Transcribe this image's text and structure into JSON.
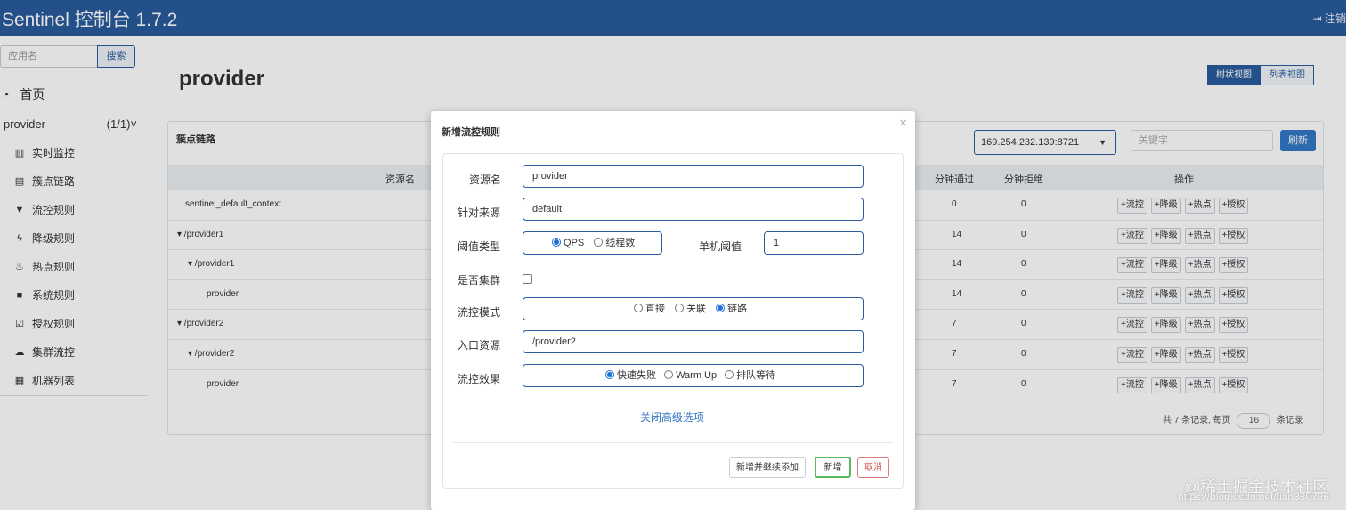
{
  "header": {
    "brand": "Sentinel 控制台 1.7.2",
    "logout": "注销"
  },
  "sidebar": {
    "search_placeholder": "应用名",
    "search_button": "搜索",
    "home": "首页",
    "app_name": "provider",
    "app_count": "(1/1)",
    "items": [
      {
        "icon": "bar-chart-icon",
        "label": "实时监控"
      },
      {
        "icon": "list-icon",
        "label": "簇点链路"
      },
      {
        "icon": "filter-icon",
        "label": "流控规则"
      },
      {
        "icon": "bolt-icon",
        "label": "降级规则"
      },
      {
        "icon": "fire-icon",
        "label": "热点规则"
      },
      {
        "icon": "lock-icon",
        "label": "系统规则"
      },
      {
        "icon": "check-square-icon",
        "label": "授权规则"
      },
      {
        "icon": "cloud-icon",
        "label": "集群流控"
      },
      {
        "icon": "th-list-icon",
        "label": "机器列表"
      }
    ]
  },
  "main": {
    "title": "provider",
    "view_tree": "树状视图",
    "view_list": "列表视图",
    "panel_title": "簇点链路",
    "machine": "169.254.232.139:8721",
    "keyword_placeholder": "关键字",
    "refresh": "刷新",
    "columns": {
      "resource": "资源名",
      "pass": "分钟通过",
      "block": "分钟拒绝",
      "ops": "操作"
    },
    "op_labels": [
      "+流控",
      "+降级",
      "+热点",
      "+授权"
    ],
    "rows": [
      {
        "name": "sentinel_default_context",
        "pass": "0",
        "block": "0"
      },
      {
        "name": "▾ /provider1",
        "pass": "14",
        "block": "0"
      },
      {
        "name": "▾ /provider1",
        "pass": "14",
        "block": "0"
      },
      {
        "name": "provider",
        "pass": "14",
        "block": "0"
      },
      {
        "name": "▾ /provider2",
        "pass": "7",
        "block": "0"
      },
      {
        "name": "▾ /provider2",
        "pass": "7",
        "block": "0"
      },
      {
        "name": "provider",
        "pass": "7",
        "block": "0"
      }
    ],
    "pager": {
      "prefix": "共 7 条记录, 每页",
      "page_size": "16",
      "suffix": "条记录"
    }
  },
  "modal": {
    "title": "新增流控规则",
    "close": "×",
    "resource_label": "资源名",
    "resource_value": "provider",
    "origin_label": "针对来源",
    "origin_value": "default",
    "threshold_type_label": "阈值类型",
    "threshold_types": [
      "QPS",
      "线程数"
    ],
    "threshold_type_selected": "QPS",
    "single_threshold_label": "单机阈值",
    "single_threshold_value": "1",
    "cluster_label": "是否集群",
    "cluster_checked": false,
    "mode_label": "流控模式",
    "modes": [
      "直接",
      "关联",
      "链路"
    ],
    "mode_selected": "链路",
    "entry_label": "入口资源",
    "entry_value": "/provider2",
    "effect_label": "流控效果",
    "effects": [
      "快速失败",
      "Warm Up",
      "排队等待"
    ],
    "effect_selected": "快速失败",
    "advanced_link": "关闭高级选项",
    "btn_add_continue": "新增并继续添加",
    "btn_add": "新增",
    "btn_cancel": "取消"
  },
  "watermark": {
    "text": "@稀土掘金技术社区",
    "url": "https://blog.csdn.net/tian330726"
  }
}
